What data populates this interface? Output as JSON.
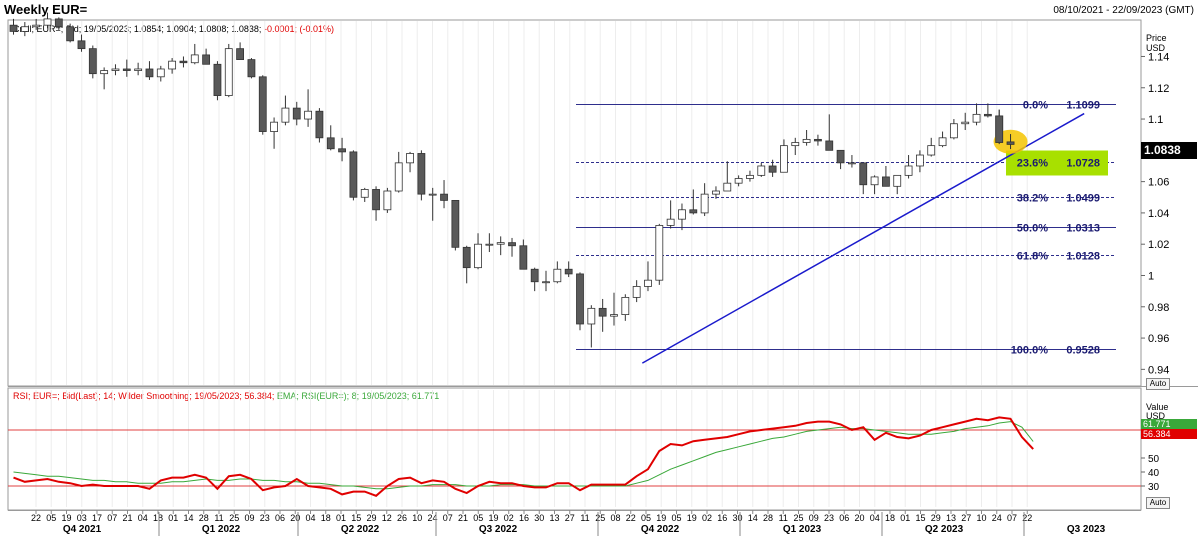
{
  "header": {
    "title": "Weekly EUR=",
    "date_range": "08/10/2021 - 22/09/2023 (GMT)",
    "legend_main": "Cndl; EUR=; Bid; 19/05/2023; 1.0854; 1.0904; 1.0808; 1.0838;",
    "legend_main_change": "-0.0001; (-0.01%)",
    "legend_rsi": "RSI; EUR=; Bid(Last); 14; Wilder Smoothing; 19/05/2023; 56.384;",
    "legend_ema": "EMA; RSI(EUR=); 8; 19/05/2023; 61.771"
  },
  "price_axis": {
    "unit_label": [
      "Price",
      "USD"
    ],
    "current_price": "1.0838",
    "auto_label": "Auto"
  },
  "rsi_axis": {
    "unit_label": [
      "Value",
      "USD"
    ],
    "ema_value": "61.771",
    "rsi_value": "56.384",
    "auto_label": "Auto"
  },
  "colors": {
    "candle_up": "#ffffff",
    "candle_down": "#595959",
    "fib_line": "#2e2e8c",
    "trendline": "#1a1acc",
    "rsi_line": "#e00000",
    "ema_line": "#3aa83a",
    "highlight_label": "#a8e000",
    "highlight_circle": "#f5c400"
  },
  "chart_data": [
    {
      "type": "candlestick",
      "ylim": [
        0.93,
        1.155
      ],
      "yticks": [
        0.94,
        0.96,
        0.98,
        1,
        1.02,
        1.04,
        1.06,
        1.08,
        1.1,
        1.12,
        1.14
      ],
      "x_tick_labels": [
        "22",
        "05",
        "19",
        "03",
        "17",
        "07",
        "21",
        "04",
        "18",
        "01",
        "14",
        "28",
        "11",
        "25",
        "09",
        "23",
        "06",
        "20",
        "04",
        "18",
        "01",
        "15",
        "29",
        "12",
        "26",
        "10",
        "24",
        "07",
        "21",
        "05",
        "19",
        "02",
        "16",
        "30",
        "13",
        "27",
        "11",
        "25",
        "08",
        "22",
        "05",
        "19",
        "05",
        "19",
        "02",
        "16",
        "30",
        "14",
        "28",
        "11",
        "25",
        "09",
        "23",
        "06",
        "20",
        "04",
        "18",
        "01",
        "15",
        "29",
        "13",
        "27",
        "10",
        "24",
        "07",
        "22"
      ],
      "x_major_labels": [
        "Q4 2021",
        "Q1 2022",
        "Q2 2022",
        "Q3 2022",
        "Q4 2022",
        "Q1 2023",
        "Q2 2023",
        "Q3 2023"
      ],
      "candles": [
        [
          1.16,
          1.164,
          1.154,
          1.156
        ],
        [
          1.156,
          1.162,
          1.153,
          1.159
        ],
        [
          1.159,
          1.164,
          1.157,
          1.16
        ],
        [
          1.16,
          1.168,
          1.158,
          1.164
        ],
        [
          1.164,
          1.165,
          1.157,
          1.159
        ],
        [
          1.159,
          1.161,
          1.149,
          1.15
        ],
        [
          1.15,
          1.154,
          1.143,
          1.145
        ],
        [
          1.145,
          1.147,
          1.126,
          1.129
        ],
        [
          1.129,
          1.133,
          1.119,
          1.131
        ],
        [
          1.131,
          1.135,
          1.128,
          1.132
        ],
        [
          1.132,
          1.138,
          1.127,
          1.131
        ],
        [
          1.131,
          1.136,
          1.128,
          1.132
        ],
        [
          1.132,
          1.137,
          1.125,
          1.127
        ],
        [
          1.127,
          1.134,
          1.124,
          1.132
        ],
        [
          1.132,
          1.139,
          1.129,
          1.137
        ],
        [
          1.137,
          1.14,
          1.133,
          1.136
        ],
        [
          1.136,
          1.148,
          1.135,
          1.141
        ],
        [
          1.141,
          1.145,
          1.135,
          1.135
        ],
        [
          1.135,
          1.137,
          1.112,
          1.115
        ],
        [
          1.115,
          1.148,
          1.114,
          1.145
        ],
        [
          1.145,
          1.149,
          1.138,
          1.138
        ],
        [
          1.138,
          1.139,
          1.126,
          1.127
        ],
        [
          1.127,
          1.128,
          1.09,
          1.092
        ],
        [
          1.092,
          1.101,
          1.081,
          1.098
        ],
        [
          1.098,
          1.115,
          1.096,
          1.107
        ],
        [
          1.107,
          1.111,
          1.096,
          1.1
        ],
        [
          1.1,
          1.119,
          1.095,
          1.105
        ],
        [
          1.105,
          1.107,
          1.085,
          1.088
        ],
        [
          1.088,
          1.096,
          1.08,
          1.081
        ],
        [
          1.081,
          1.088,
          1.073,
          1.079
        ],
        [
          1.079,
          1.08,
          1.048,
          1.05
        ],
        [
          1.05,
          1.056,
          1.047,
          1.055
        ],
        [
          1.055,
          1.057,
          1.035,
          1.042
        ],
        [
          1.042,
          1.056,
          1.04,
          1.054
        ],
        [
          1.054,
          1.079,
          1.053,
          1.072
        ],
        [
          1.072,
          1.079,
          1.066,
          1.078
        ],
        [
          1.078,
          1.08,
          1.048,
          1.052
        ],
        [
          1.052,
          1.056,
          1.035,
          1.052
        ],
        [
          1.052,
          1.061,
          1.043,
          1.048
        ],
        [
          1.048,
          1.048,
          1.016,
          1.018
        ],
        [
          1.018,
          1.019,
          0.995,
          1.005
        ],
        [
          1.005,
          1.027,
          1.004,
          1.02
        ],
        [
          1.02,
          1.027,
          1.015,
          1.02
        ],
        [
          1.02,
          1.025,
          1.013,
          1.021
        ],
        [
          1.021,
          1.024,
          1.012,
          1.019
        ],
        [
          1.019,
          1.023,
          1.004,
          1.004
        ],
        [
          1.004,
          1.005,
          0.99,
          0.996
        ],
        [
          0.996,
          1.003,
          0.99,
          0.996
        ],
        [
          0.996,
          1.009,
          0.995,
          1.004
        ],
        [
          1.004,
          1.009,
          0.999,
          1.001
        ],
        [
          1.001,
          1.002,
          0.965,
          0.969
        ],
        [
          0.969,
          0.981,
          0.954,
          0.979
        ],
        [
          0.979,
          0.985,
          0.964,
          0.974
        ],
        [
          0.974,
          0.989,
          0.968,
          0.975
        ],
        [
          0.975,
          0.988,
          0.971,
          0.986
        ],
        [
          0.986,
          0.997,
          0.983,
          0.993
        ],
        [
          0.993,
          1.009,
          0.99,
          0.997
        ],
        [
          0.997,
          1.033,
          0.994,
          1.032
        ],
        [
          1.032,
          1.048,
          1.03,
          1.036
        ],
        [
          1.036,
          1.046,
          1.029,
          1.042
        ],
        [
          1.042,
          1.055,
          1.039,
          1.04
        ],
        [
          1.04,
          1.059,
          1.038,
          1.052
        ],
        [
          1.052,
          1.057,
          1.049,
          1.054
        ],
        [
          1.054,
          1.073,
          1.054,
          1.059
        ],
        [
          1.059,
          1.064,
          1.057,
          1.062
        ],
        [
          1.062,
          1.067,
          1.06,
          1.064
        ],
        [
          1.064,
          1.072,
          1.063,
          1.07
        ],
        [
          1.07,
          1.074,
          1.063,
          1.066
        ],
        [
          1.066,
          1.087,
          1.066,
          1.083
        ],
        [
          1.083,
          1.088,
          1.077,
          1.085
        ],
        [
          1.085,
          1.093,
          1.083,
          1.087
        ],
        [
          1.087,
          1.09,
          1.083,
          1.086
        ],
        [
          1.086,
          1.103,
          1.084,
          1.08
        ],
        [
          1.08,
          1.08,
          1.068,
          1.072
        ],
        [
          1.072,
          1.077,
          1.069,
          1.072
        ],
        [
          1.072,
          1.071,
          1.052,
          1.058
        ],
        [
          1.058,
          1.064,
          1.052,
          1.063
        ],
        [
          1.063,
          1.07,
          1.059,
          1.057
        ],
        [
          1.057,
          1.062,
          1.052,
          1.064
        ],
        [
          1.064,
          1.077,
          1.062,
          1.07
        ],
        [
          1.07,
          1.08,
          1.066,
          1.077
        ],
        [
          1.077,
          1.088,
          1.076,
          1.083
        ],
        [
          1.083,
          1.092,
          1.082,
          1.088
        ],
        [
          1.088,
          1.1,
          1.087,
          1.097
        ],
        [
          1.097,
          1.104,
          1.093,
          1.098
        ],
        [
          1.098,
          1.11,
          1.096,
          1.103
        ],
        [
          1.103,
          1.11,
          1.101,
          1.102
        ],
        [
          1.102,
          1.106,
          1.084,
          1.085
        ],
        [
          1.0854,
          1.0904,
          1.0808,
          1.0838
        ]
      ]
    },
    {
      "type": "fibonacci_retracement",
      "levels": [
        {
          "label": "0.0%",
          "value": "1.1099",
          "price": 1.1099,
          "style": "solid"
        },
        {
          "label": "23.6%",
          "value": "1.0728",
          "price": 1.0728,
          "style": "dashed",
          "highlight": true
        },
        {
          "label": "38.2%",
          "value": "1.0499",
          "price": 1.0499,
          "style": "dashed"
        },
        {
          "label": "50.0%",
          "value": "1.0313",
          "price": 1.0313,
          "style": "solid"
        },
        {
          "label": "61.8%",
          "value": "1.0128",
          "price": 1.0128,
          "style": "dashed"
        },
        {
          "label": "100.0%",
          "value": "0.9528",
          "price": 0.9528,
          "style": "solid"
        }
      ],
      "trendline": {
        "from": [
          55.5,
          0.944
        ],
        "to": [
          94.5,
          1.1035
        ]
      }
    },
    {
      "type": "line",
      "ylim": [
        15,
        90
      ],
      "yticks": [
        30,
        40,
        50
      ],
      "reference_lines": [
        30,
        70
      ],
      "series": [
        {
          "name": "RSI",
          "values": [
            36,
            33,
            34,
            35,
            33,
            32,
            30,
            31,
            30,
            30,
            30,
            30,
            28,
            34,
            36,
            36,
            38,
            36,
            28,
            37,
            38,
            35,
            27,
            29,
            30,
            35,
            30,
            29,
            28,
            24,
            26,
            26,
            23,
            30,
            35,
            36,
            32,
            34,
            33,
            28,
            25,
            30,
            33,
            32,
            32,
            30,
            29,
            29,
            32,
            32,
            27,
            31,
            31,
            31,
            31,
            37,
            42,
            55,
            60,
            59,
            62,
            63,
            64,
            65,
            67,
            69,
            70,
            71,
            72,
            73,
            75,
            76,
            76,
            74,
            70,
            72,
            63,
            68,
            65,
            64,
            66,
            70,
            72,
            74,
            76,
            78,
            77,
            79,
            78,
            65,
            56.384
          ]
        },
        {
          "name": "EMA",
          "values": [
            40,
            39,
            38,
            37,
            37,
            36,
            35,
            34,
            34,
            33,
            33,
            32,
            32,
            32,
            33,
            33,
            34,
            35,
            34,
            34,
            35,
            35,
            34,
            34,
            33,
            33,
            32,
            32,
            31,
            30,
            30,
            29,
            28,
            28,
            29,
            30,
            30,
            31,
            31,
            31,
            30,
            30,
            30,
            31,
            31,
            31,
            30,
            30,
            30,
            30,
            30,
            30,
            30,
            30,
            30,
            32,
            34,
            38,
            42,
            45,
            48,
            51,
            54,
            56,
            58,
            60,
            62,
            64,
            65,
            67,
            69,
            70,
            71,
            72,
            71,
            71,
            70,
            69,
            68,
            67,
            67,
            67,
            68,
            69,
            71,
            72,
            73,
            75,
            76,
            72,
            61.771
          ]
        }
      ]
    }
  ]
}
